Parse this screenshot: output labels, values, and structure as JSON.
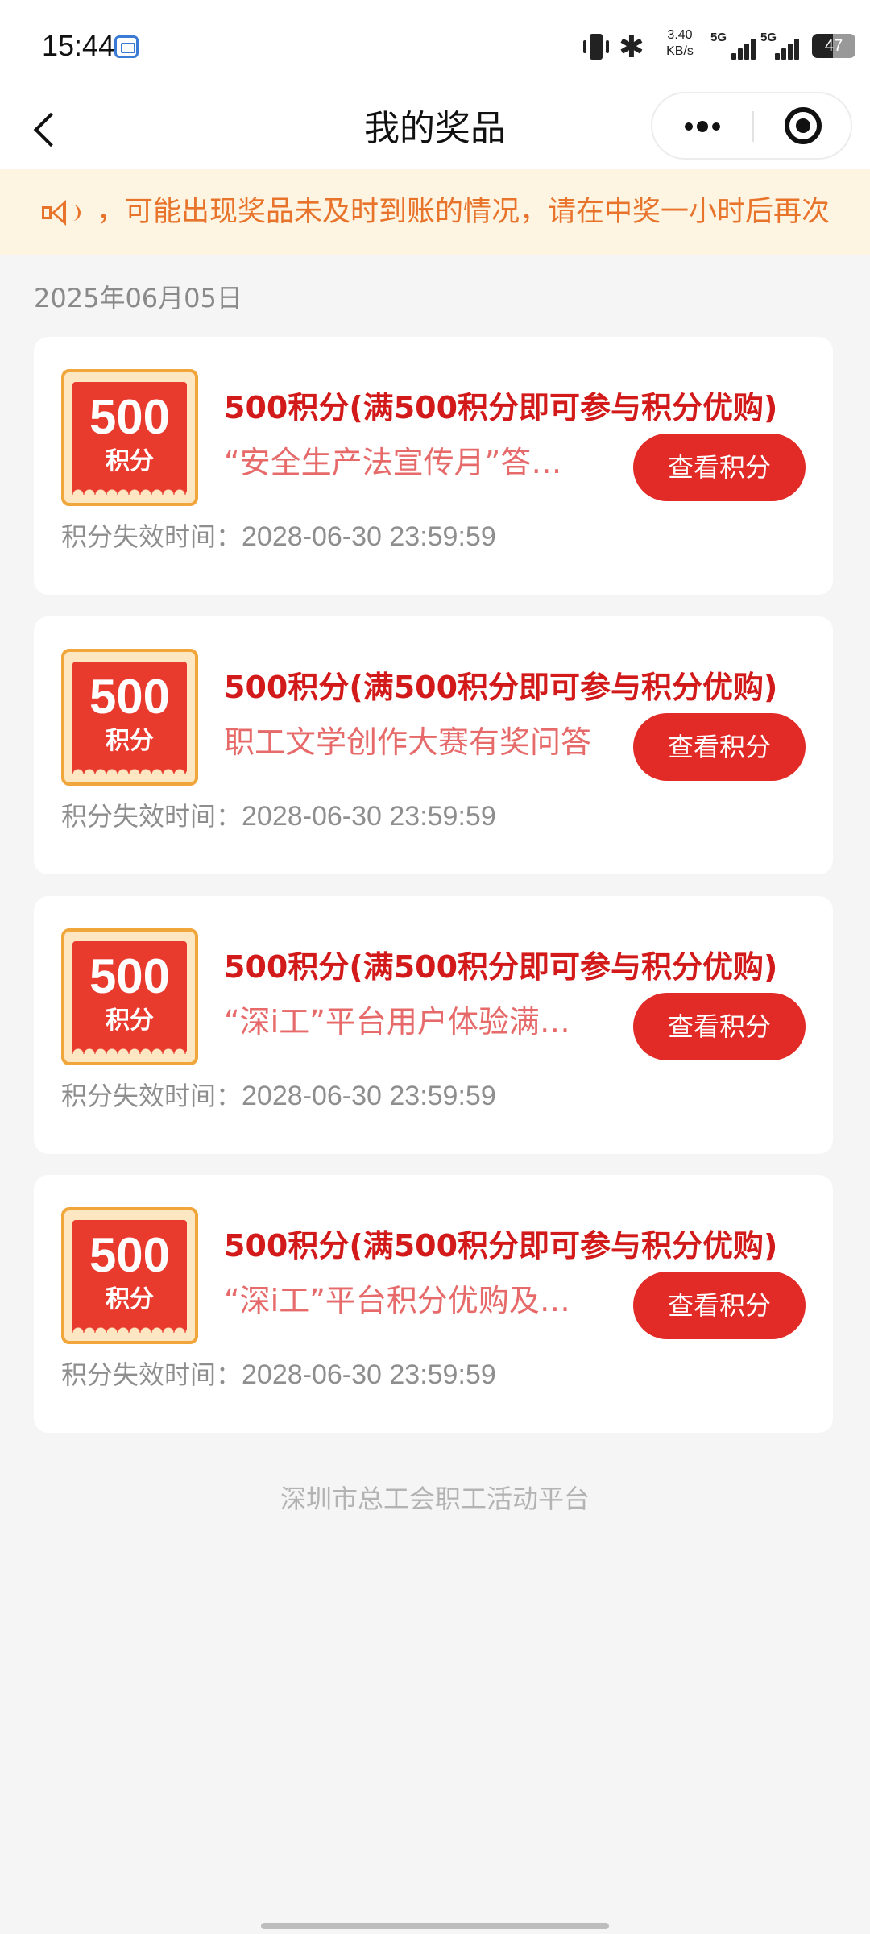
{
  "status_bar": {
    "time": "15:44",
    "bluetooth_glyph": "✱",
    "net_speed": "3.40",
    "net_unit": "KB/s",
    "sim1_tag": "5G",
    "sim2_tag": "5G",
    "battery": "47"
  },
  "nav": {
    "title": "我的奖品"
  },
  "notice": {
    "text": "，可能出现奖品未及时到账的情况，请在中奖一小时后再次"
  },
  "list": {
    "date": "2025年06月05日",
    "expire_label": "积分失效时间：",
    "button_label": "查看积分",
    "items": [
      {
        "amount": "500",
        "unit": "积分",
        "title": "500积分(满500积分即可参与积分优购)",
        "source": "“安全生产法宣传月”答…",
        "expire": "2028-06-30 23:59:59"
      },
      {
        "amount": "500",
        "unit": "积分",
        "title": "500积分(满500积分即可参与积分优购)",
        "source": "职工文学创作大赛有奖问答",
        "expire": "2028-06-30 23:59:59"
      },
      {
        "amount": "500",
        "unit": "积分",
        "title": "500积分(满500积分即可参与积分优购)",
        "source": "“深i工”平台用户体验满…",
        "expire": "2028-06-30 23:59:59"
      },
      {
        "amount": "500",
        "unit": "积分",
        "title": "500积分(满500积分即可参与积分优购)",
        "source": "“深i工”平台积分优购及…",
        "expire": "2028-06-30 23:59:59"
      }
    ]
  },
  "footer": {
    "text": "深圳市总工会职工活动平台"
  }
}
